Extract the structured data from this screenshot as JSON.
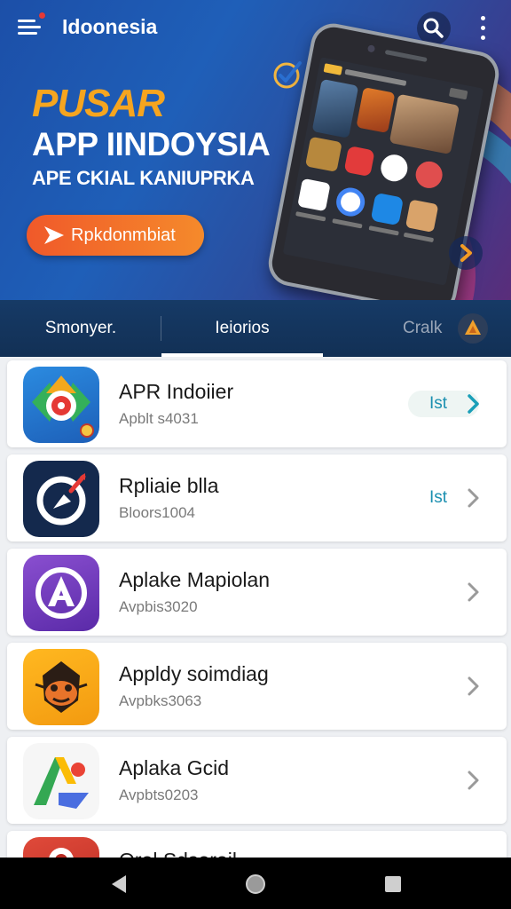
{
  "header": {
    "title": "Idoonesia",
    "menu_icon": "menu-icon",
    "search_icon": "search-icon",
    "more_icon": "more-vertical-icon"
  },
  "hero": {
    "line1": "PUSAR",
    "line2": "APP IINDOYSIA",
    "line3": "APE CKIAL KANIUPRKA",
    "cta_label": "Rpkdonmbiat",
    "colors": {
      "accent": "#f6a51f",
      "cta": "#f0592a",
      "background": "#1f5fb8"
    }
  },
  "tabs": [
    {
      "label": "Smonyer."
    },
    {
      "label": "Ieiorios"
    },
    {
      "label": "Cralk"
    }
  ],
  "apps": [
    {
      "name": "APR Indoiier",
      "sub": "Apblt s4031",
      "action": "Ist",
      "icon": "target-app-icon"
    },
    {
      "name": "Rpliaie blla",
      "sub": "Bloors1004",
      "action": "Ist",
      "icon": "compass-app-icon"
    },
    {
      "name": "Aplake Mapiolan",
      "sub": "Avpbis3020",
      "action": "",
      "icon": "letter-a-app-icon"
    },
    {
      "name": "Appldy soimdiag",
      "sub": "Avpbks3063",
      "action": "",
      "icon": "mask-app-icon"
    },
    {
      "name": "Aplaka Gcid",
      "sub": "Avpbts0203",
      "action": "",
      "icon": "arrow-app-icon"
    },
    {
      "name": "Orol   Sdsoroil",
      "sub": "",
      "action": "",
      "icon": "red-app-icon"
    }
  ],
  "navbar": {
    "back_icon": "back-icon",
    "home_icon": "home-icon",
    "recents_icon": "recents-icon"
  }
}
